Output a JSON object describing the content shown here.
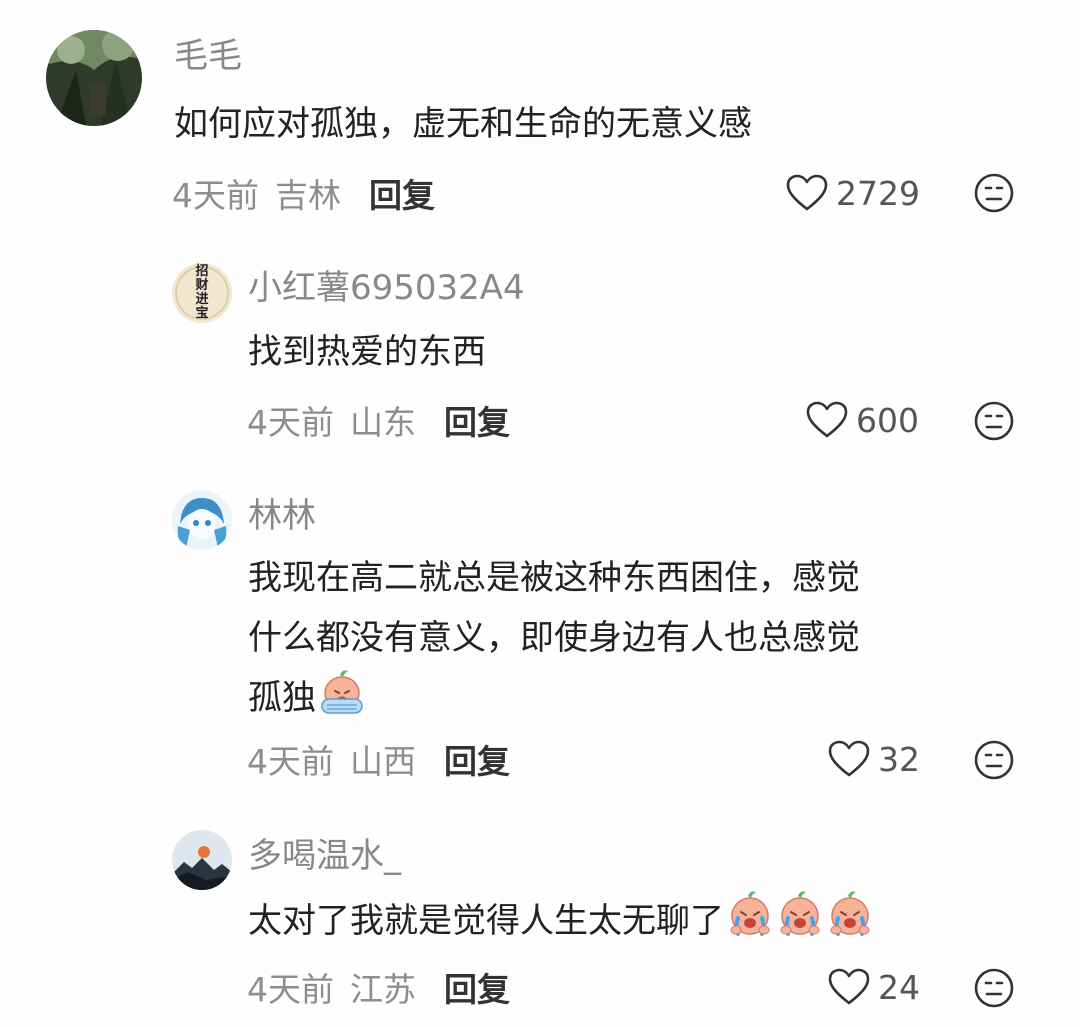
{
  "comments": [
    {
      "username": "毛毛",
      "text": "如何应对孤独，虚无和生命的无意义感",
      "time": "4天前",
      "location": "吉林",
      "reply_label": "回复",
      "likes": "2729"
    },
    {
      "username": "小红薯695032A4",
      "avatar_text": "招财进宝",
      "text": "找到热爱的东西",
      "time": "4天前",
      "location": "山东",
      "reply_label": "回复",
      "likes": "600"
    },
    {
      "username": "林林",
      "text_lines": [
        "我现在高二就总是被这种东西困住，感觉",
        "什么都没有意义，即使身边有人也总感觉",
        "孤独"
      ],
      "time": "4天前",
      "location": "山西",
      "reply_label": "回复",
      "likes": "32"
    },
    {
      "username": "多喝温水_",
      "text": "太对了我就是觉得人生太无聊了",
      "time": "4天前",
      "location": "江苏",
      "reply_label": "回复",
      "likes": "24"
    }
  ],
  "icons": {
    "like": "heart-outline-icon",
    "dislike": "neutral-face-icon",
    "sticker": "crying-peach-sticker"
  },
  "colors": {
    "username": "#888888",
    "meta": "#8d8d8d",
    "text": "#222222"
  }
}
